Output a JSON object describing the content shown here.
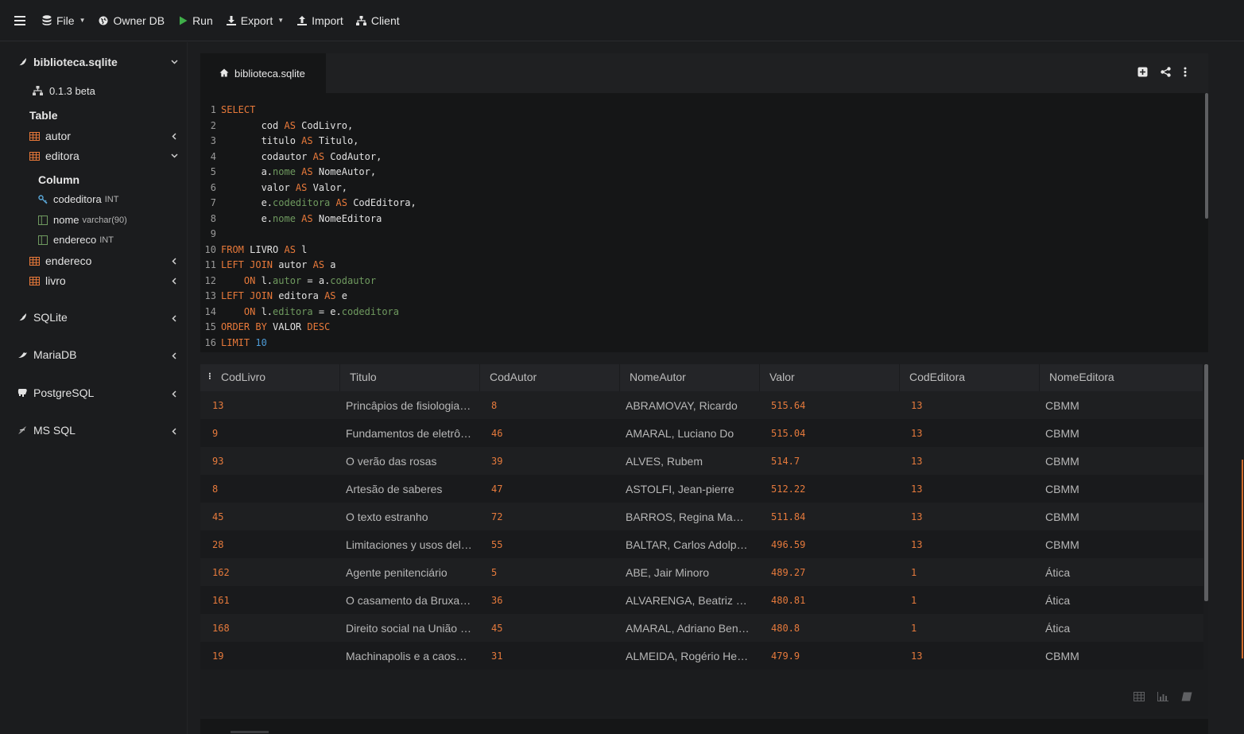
{
  "toolbar": {
    "items": [
      {
        "label": "File",
        "icon": "database-icon",
        "has_caret": true
      },
      {
        "label": "Owner DB",
        "icon": "globe-icon",
        "has_caret": false
      },
      {
        "label": "Run",
        "icon": "play-icon",
        "has_caret": false
      },
      {
        "label": "Export",
        "icon": "download-icon",
        "has_caret": true
      },
      {
        "label": "Import",
        "icon": "upload-icon",
        "has_caret": false
      },
      {
        "label": "Client",
        "icon": "sitemap-icon",
        "has_caret": false
      }
    ]
  },
  "sidebar": {
    "databases": [
      {
        "label": "biblioteca.sqlite",
        "expanded": true
      },
      {
        "label": "SQLite"
      },
      {
        "label": "MariaDB"
      },
      {
        "label": "PostgreSQL"
      },
      {
        "label": "MS SQL"
      }
    ],
    "version": "0.1.3 beta",
    "table_heading": "Table",
    "tables": [
      "autor",
      "editora",
      "endereco",
      "livro"
    ],
    "column_heading": "Column",
    "columns": [
      {
        "name": "codeditora",
        "type": "INT",
        "icon": "key-icon"
      },
      {
        "name": "nome",
        "type": "varchar(90)",
        "icon": "column-icon"
      },
      {
        "name": "endereco",
        "type": "INT",
        "icon": "column-icon"
      }
    ]
  },
  "editor": {
    "tab_label": "biblioteca.sqlite",
    "lines": [
      [
        [
          "kw",
          "SELECT"
        ]
      ],
      [
        [
          "tx",
          "       cod "
        ],
        [
          "kw",
          "AS"
        ],
        [
          "tx",
          " CodLivro,"
        ]
      ],
      [
        [
          "tx",
          "       titulo "
        ],
        [
          "kw",
          "AS"
        ],
        [
          "tx",
          " Titulo,"
        ]
      ],
      [
        [
          "tx",
          "       codautor "
        ],
        [
          "kw",
          "AS"
        ],
        [
          "tx",
          " CodAutor,"
        ]
      ],
      [
        [
          "tx",
          "       a."
        ],
        [
          "fn",
          "nome"
        ],
        [
          "tx",
          " "
        ],
        [
          "kw",
          "AS"
        ],
        [
          "tx",
          " NomeAutor,"
        ]
      ],
      [
        [
          "tx",
          "       valor "
        ],
        [
          "kw",
          "AS"
        ],
        [
          "tx",
          " Valor,"
        ]
      ],
      [
        [
          "tx",
          "       e."
        ],
        [
          "fn",
          "codeditora"
        ],
        [
          "tx",
          " "
        ],
        [
          "kw",
          "AS"
        ],
        [
          "tx",
          " CodEditora,"
        ]
      ],
      [
        [
          "tx",
          "       e."
        ],
        [
          "fn",
          "nome"
        ],
        [
          "tx",
          " "
        ],
        [
          "kw",
          "AS"
        ],
        [
          "tx",
          " NomeEditora"
        ]
      ],
      [],
      [
        [
          "kw",
          "FROM"
        ],
        [
          "tx",
          " LIVRO "
        ],
        [
          "kw",
          "AS"
        ],
        [
          "tx",
          " l"
        ]
      ],
      [
        [
          "kw",
          "LEFT JOIN"
        ],
        [
          "tx",
          " autor "
        ],
        [
          "kw",
          "AS"
        ],
        [
          "tx",
          " a"
        ]
      ],
      [
        [
          "tx",
          "    "
        ],
        [
          "kw",
          "ON"
        ],
        [
          "tx",
          " l."
        ],
        [
          "fn",
          "autor"
        ],
        [
          "tx",
          " = a."
        ],
        [
          "fn",
          "codautor"
        ]
      ],
      [
        [
          "kw",
          "LEFT JOIN"
        ],
        [
          "tx",
          " editora "
        ],
        [
          "kw",
          "AS"
        ],
        [
          "tx",
          " e"
        ]
      ],
      [
        [
          "tx",
          "    "
        ],
        [
          "kw",
          "ON"
        ],
        [
          "tx",
          " l."
        ],
        [
          "fn",
          "editora"
        ],
        [
          "tx",
          " = e."
        ],
        [
          "fn",
          "codeditora"
        ]
      ],
      [
        [
          "kw",
          "ORDER BY"
        ],
        [
          "tx",
          " VALOR "
        ],
        [
          "kw",
          "DESC"
        ]
      ],
      [
        [
          "kw",
          "LIMIT"
        ],
        [
          "tx",
          " "
        ],
        [
          "num",
          "10"
        ]
      ]
    ]
  },
  "grid": {
    "columns": [
      "CodLivro",
      "Titulo",
      "CodAutor",
      "NomeAutor",
      "Valor",
      "CodEditora",
      "NomeEditora"
    ],
    "rows": [
      [
        "13",
        "Princâpios de fisiologia a...",
        "8",
        "ABRAMOVAY, Ricardo",
        "515.64",
        "13",
        "CBMM"
      ],
      [
        "9",
        "Fundamentos de eletrônica",
        "46",
        "AMARAL, Luciano Do",
        "515.04",
        "13",
        "CBMM"
      ],
      [
        "93",
        "O verão das rosas",
        "39",
        "ALVES, Rubem",
        "514.7",
        "13",
        "CBMM"
      ],
      [
        "8",
        "Artesão de saberes",
        "47",
        "ASTOLFI, Jean-pierre",
        "512.22",
        "13",
        "CBMM"
      ],
      [
        "45",
        "O texto estranho",
        "72",
        "BARROS, Regina Mambeli",
        "511.84",
        "13",
        "CBMM"
      ],
      [
        "28",
        "Limitaciones y usos del d...",
        "55",
        "BALTAR, Carlos Adolpho...",
        "496.59",
        "13",
        "CBMM"
      ],
      [
        "162",
        "Agente penitenciário",
        "5",
        "ABE, Jair Minoro",
        "489.27",
        "1",
        "Ática"
      ],
      [
        "161",
        "O casamento da Bruxa O...",
        "36",
        "ALVARENGA, Beatriz Go...",
        "480.81",
        "1",
        "Ática"
      ],
      [
        "168",
        "Direito social na União E...",
        "45",
        "AMARAL, Adriano Benay...",
        "480.8",
        "1",
        "Ática"
      ],
      [
        "19",
        "Machinapolis e a caosmo...",
        "31",
        "ALMEIDA, Rogério Henri...",
        "479.9",
        "13",
        "CBMM"
      ]
    ]
  },
  "colors": {
    "accent": "#e8793a",
    "function": "#6f9a5f",
    "number": "#4d9bd6",
    "background": "#1c1d1f"
  }
}
